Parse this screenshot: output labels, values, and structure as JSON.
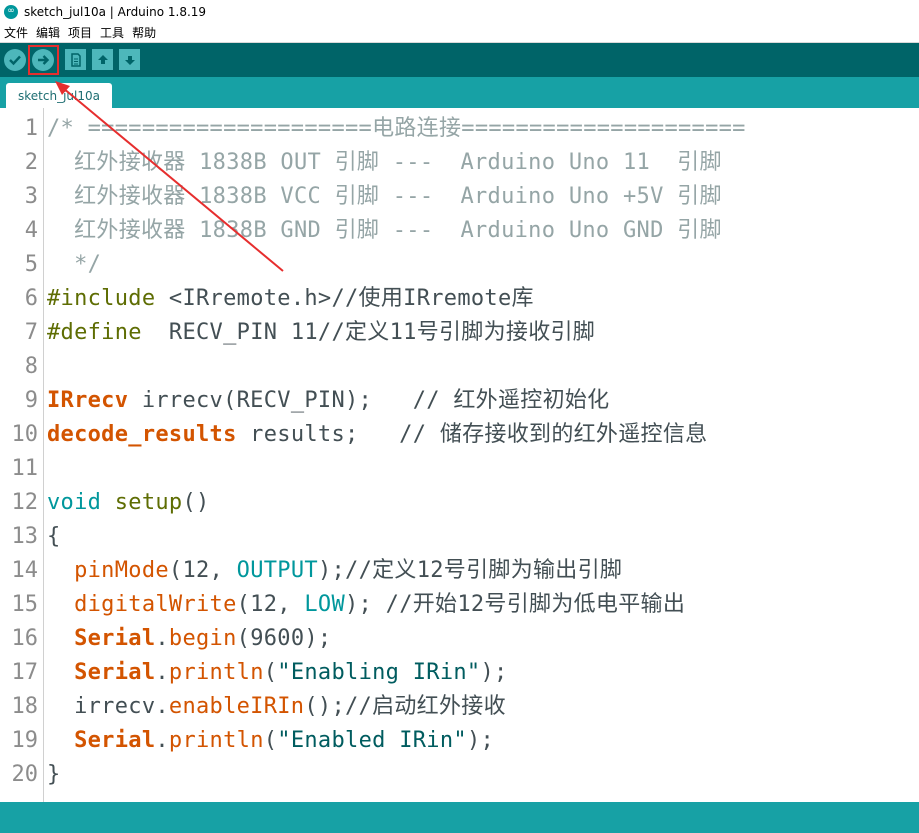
{
  "window": {
    "title": "sketch_jul10a | Arduino 1.8.19"
  },
  "menu": [
    "文件",
    "编辑",
    "项目",
    "工具",
    "帮助"
  ],
  "toolbar": {
    "buttons": [
      "verify-icon",
      "upload-icon",
      "new-icon",
      "open-icon",
      "save-icon"
    ]
  },
  "tab": {
    "label": "sketch_jul10a"
  },
  "colors": {
    "toolbar": "#006468",
    "tabstrip": "#17a1a5",
    "button": "#4db7bb",
    "highlight": "#e62e2e"
  },
  "code": [
    {
      "n": "1",
      "parts": [
        {
          "c": "c-comment",
          "t": "/* =====================电路连接====================="
        }
      ]
    },
    {
      "n": "2",
      "parts": [
        {
          "c": "c-comment",
          "t": "  红外接收器 1838B OUT 引脚 ---  Arduino Uno 11  引脚"
        }
      ]
    },
    {
      "n": "3",
      "parts": [
        {
          "c": "c-comment",
          "t": "  红外接收器 1838B VCC 引脚 ---  Arduino Uno +5V 引脚"
        }
      ]
    },
    {
      "n": "4",
      "parts": [
        {
          "c": "c-comment",
          "t": "  红外接收器 1838B GND 引脚 ---  Arduino Uno GND 引脚"
        }
      ]
    },
    {
      "n": "5",
      "parts": [
        {
          "c": "c-comment",
          "t": "  */"
        }
      ]
    },
    {
      "n": "6",
      "parts": [
        {
          "c": "c-dir",
          "t": "#include"
        },
        {
          "c": "c-plain",
          "t": " <IRremote.h>//使用IRremote库"
        }
      ]
    },
    {
      "n": "7",
      "parts": [
        {
          "c": "c-dir",
          "t": "#define"
        },
        {
          "c": "c-plain",
          "t": "  RECV_PIN 11//定义11号引脚为接收引脚"
        }
      ]
    },
    {
      "n": "8",
      "parts": []
    },
    {
      "n": "9",
      "parts": [
        {
          "c": "c-key",
          "t": "IRrecv"
        },
        {
          "c": "c-plain",
          "t": " irrecv(RECV_PIN);   // 红外遥控初始化"
        }
      ]
    },
    {
      "n": "10",
      "parts": [
        {
          "c": "c-key",
          "t": "decode_results"
        },
        {
          "c": "c-plain",
          "t": " results;   // 储存接收到的红外遥控信息"
        }
      ]
    },
    {
      "n": "11",
      "parts": []
    },
    {
      "n": "12",
      "parts": [
        {
          "c": "c-type",
          "t": "void"
        },
        {
          "c": "c-plain",
          "t": " "
        },
        {
          "c": "c-dir",
          "t": "setup"
        },
        {
          "c": "c-plain",
          "t": "()"
        }
      ]
    },
    {
      "n": "13",
      "parts": [
        {
          "c": "c-plain",
          "t": "{"
        }
      ]
    },
    {
      "n": "14",
      "parts": [
        {
          "c": "c-plain",
          "t": "  "
        },
        {
          "c": "c-func",
          "t": "pinMode"
        },
        {
          "c": "c-plain",
          "t": "(12, "
        },
        {
          "c": "c-const",
          "t": "OUTPUT"
        },
        {
          "c": "c-plain",
          "t": ");//定义12号引脚为输出引脚"
        }
      ]
    },
    {
      "n": "15",
      "parts": [
        {
          "c": "c-plain",
          "t": "  "
        },
        {
          "c": "c-func",
          "t": "digitalWrite"
        },
        {
          "c": "c-plain",
          "t": "(12, "
        },
        {
          "c": "c-const",
          "t": "LOW"
        },
        {
          "c": "c-plain",
          "t": "); //开始12号引脚为低电平输出"
        }
      ]
    },
    {
      "n": "16",
      "parts": [
        {
          "c": "c-plain",
          "t": "  "
        },
        {
          "c": "c-key",
          "t": "Serial"
        },
        {
          "c": "c-plain",
          "t": "."
        },
        {
          "c": "c-func",
          "t": "begin"
        },
        {
          "c": "c-plain",
          "t": "(9600);"
        }
      ]
    },
    {
      "n": "17",
      "parts": [
        {
          "c": "c-plain",
          "t": "  "
        },
        {
          "c": "c-key",
          "t": "Serial"
        },
        {
          "c": "c-plain",
          "t": "."
        },
        {
          "c": "c-func",
          "t": "println"
        },
        {
          "c": "c-plain",
          "t": "("
        },
        {
          "c": "c-str",
          "t": "\"Enabling IRin\""
        },
        {
          "c": "c-plain",
          "t": ");"
        }
      ]
    },
    {
      "n": "18",
      "parts": [
        {
          "c": "c-plain",
          "t": "  irrecv."
        },
        {
          "c": "c-func",
          "t": "enableIRIn"
        },
        {
          "c": "c-plain",
          "t": "();//启动红外接收"
        }
      ]
    },
    {
      "n": "19",
      "parts": [
        {
          "c": "c-plain",
          "t": "  "
        },
        {
          "c": "c-key",
          "t": "Serial"
        },
        {
          "c": "c-plain",
          "t": "."
        },
        {
          "c": "c-func",
          "t": "println"
        },
        {
          "c": "c-plain",
          "t": "("
        },
        {
          "c": "c-str",
          "t": "\"Enabled IRin\""
        },
        {
          "c": "c-plain",
          "t": ");"
        }
      ]
    },
    {
      "n": "20",
      "parts": [
        {
          "c": "c-plain",
          "t": "}"
        }
      ]
    }
  ]
}
